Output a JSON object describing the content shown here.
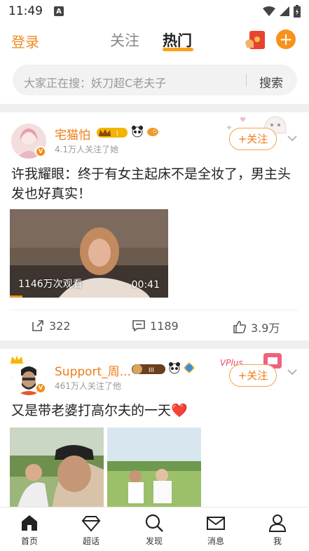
{
  "status_bar": {
    "time": "11:49",
    "notif_icon": "A"
  },
  "top_nav": {
    "login": "登录",
    "tabs": [
      "关注",
      "热门"
    ],
    "active_tab": "热门"
  },
  "search": {
    "placeholder": "大家正在搜：妖刀超C老夫子",
    "button": "搜索"
  },
  "posts": [
    {
      "username": "宅猫怕",
      "fans": "4.1万人关注了她",
      "follow": "+关注",
      "text": "许我耀眼：终于有女主起床不是全妆了，男主头发也好真实！",
      "video": {
        "views": "1146万次观看",
        "duration": "00:41",
        "progress": 0.08
      },
      "actions": {
        "repost": "322",
        "comment": "1189",
        "like": "3.9万"
      }
    },
    {
      "username": "Support_周...",
      "fans": "461万人关注了他",
      "follow": "+关注",
      "text": "又是带老婆打高尔夫的一天❤️"
    }
  ],
  "bottom_nav": [
    "首页",
    "超话",
    "发现",
    "消息",
    "我"
  ],
  "colors": {
    "accent": "#f07b17",
    "accent_bg": "#f7921c"
  }
}
